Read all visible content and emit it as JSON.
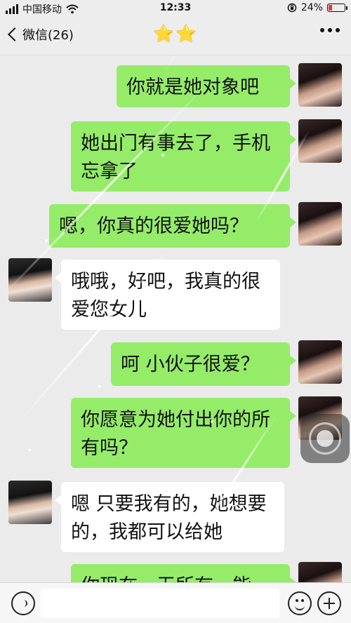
{
  "status_bar": {
    "carrier": "中国移动",
    "wifi_icon": "wifi-icon",
    "time": "12:33",
    "lock_icon": "orientation-lock-icon",
    "battery_percent": "24%",
    "battery_level": 0.24,
    "battery_color": "#e53935"
  },
  "nav": {
    "back_label": "微信(26)",
    "title": "⭐⭐",
    "more_icon": "more-icon"
  },
  "messages": [
    {
      "side": "out",
      "text": "你就是她对象吧"
    },
    {
      "side": "out",
      "text": "她出门有事去了，手机忘拿了"
    },
    {
      "side": "out",
      "text": "嗯，你真的很爱她吗？"
    },
    {
      "side": "in",
      "text": "哦哦，好吧，我真的很爱您女儿"
    },
    {
      "side": "out",
      "text": "呵 小伙子很爱？"
    },
    {
      "side": "out",
      "text": "你愿意为她付出你的所有吗？"
    },
    {
      "side": "in",
      "text": "嗯 只要我有的，她想要的，我都可以给她"
    },
    {
      "side": "out",
      "text": "你现在一无所有，能"
    }
  ],
  "input_bar": {
    "voice_icon": "voice-icon",
    "placeholder": "",
    "emoji_icon": "emoji-icon",
    "plus_icon": "plus-icon"
  },
  "colors": {
    "outgoing_bubble": "#95ec69",
    "incoming_bubble": "#ffffff",
    "background": "#ebebeb"
  }
}
